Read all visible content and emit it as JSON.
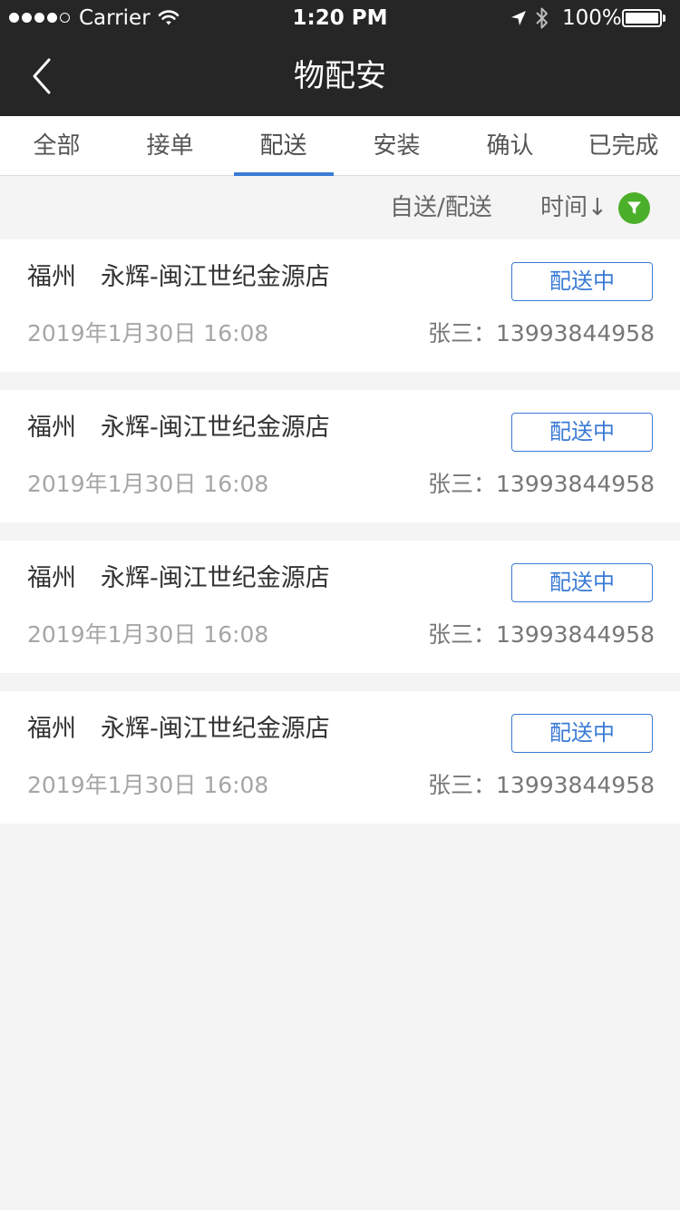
{
  "status_bar": {
    "carrier": "Carrier",
    "time": "1:20 PM",
    "battery": "100%",
    "battery_level": 1.0,
    "icons": [
      "signal-dots",
      "wifi-icon",
      "location-arrow-icon",
      "bluetooth-icon",
      "battery-icon"
    ]
  },
  "nav": {
    "title": "物配安",
    "back_icon": "chevron-left-icon"
  },
  "tabs": [
    {
      "label": "全部",
      "active": false
    },
    {
      "label": "接单",
      "active": false
    },
    {
      "label": "配送",
      "active": true
    },
    {
      "label": "安装",
      "active": false
    },
    {
      "label": "确认",
      "active": false
    },
    {
      "label": "已完成",
      "active": false
    }
  ],
  "filter": {
    "type_label": "自送/配送",
    "sort_label": "时间↓",
    "filter_icon": "funnel-icon",
    "accent_color": "#4caf2a"
  },
  "colors": {
    "header_bg": "#262626",
    "accent_blue": "#3a7bd5",
    "page_bg": "#f4f4f4"
  },
  "orders": [
    {
      "store": "福州　永辉-闽江世纪金源店",
      "status": "配送中",
      "time": "2019年1月30日 16:08",
      "contact": "张三：13993844958"
    },
    {
      "store": "福州　永辉-闽江世纪金源店",
      "status": "配送中",
      "time": "2019年1月30日 16:08",
      "contact": "张三：13993844958"
    },
    {
      "store": "福州　永辉-闽江世纪金源店",
      "status": "配送中",
      "time": "2019年1月30日 16:08",
      "contact": "张三：13993844958"
    },
    {
      "store": "福州　永辉-闽江世纪金源店",
      "status": "配送中",
      "time": "2019年1月30日 16:08",
      "contact": "张三：13993844958"
    }
  ]
}
